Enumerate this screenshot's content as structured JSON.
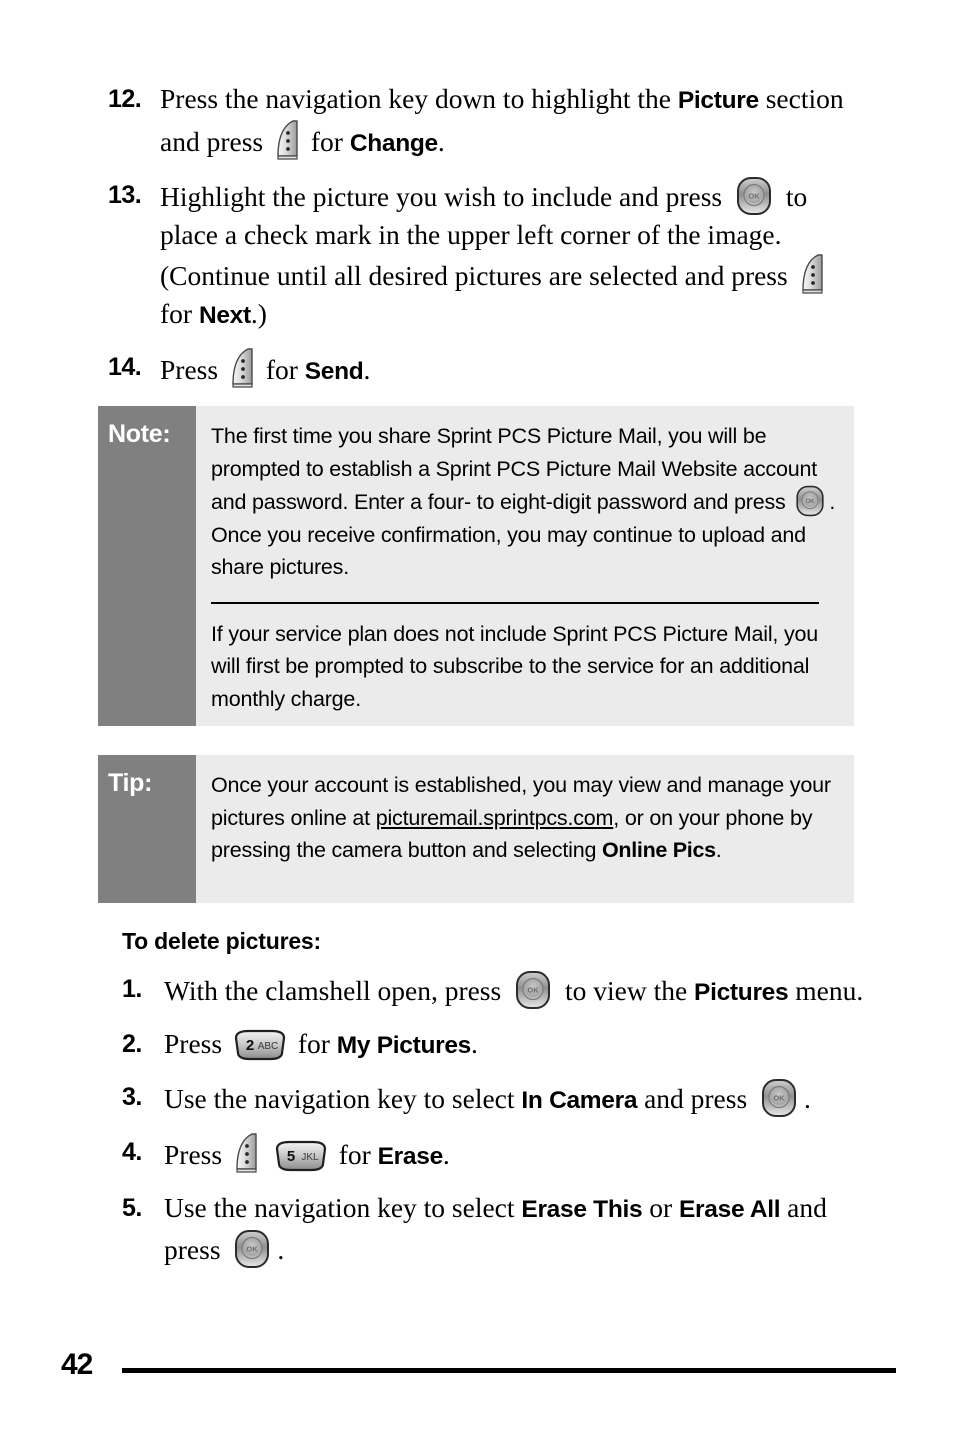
{
  "document": {
    "page_number": "42",
    "colors": {
      "callout_label_bg": "#808080",
      "callout_body_bg": "#ebebeb",
      "text": "#000000",
      "label_text": "#ffffff"
    }
  },
  "steps_top": [
    {
      "number": "12.",
      "parts": [
        {
          "type": "text",
          "value": "Press the navigation key down to highlight the "
        },
        {
          "type": "bold",
          "value": "Picture"
        },
        {
          "type": "text",
          "value": " section and press "
        },
        {
          "type": "icon",
          "value": "softkey-right-icon"
        },
        {
          "type": "text",
          "value": " for "
        },
        {
          "type": "bold",
          "value": "Change"
        },
        {
          "type": "text",
          "value": "."
        }
      ]
    },
    {
      "number": "13.",
      "parts": [
        {
          "type": "text",
          "value": "Highlight the picture you wish to include and press "
        },
        {
          "type": "icon",
          "value": "ok-navigation-key-icon"
        },
        {
          "type": "text",
          "value": " to place a check mark in the upper left corner of the image. (Continue until all desired pictures are selected and press "
        },
        {
          "type": "icon",
          "value": "softkey-right-icon"
        },
        {
          "type": "text",
          "value": " for "
        },
        {
          "type": "bold",
          "value": "Next"
        },
        {
          "type": "text",
          "value": ".)"
        }
      ]
    },
    {
      "number": "14.",
      "parts": [
        {
          "type": "text",
          "value": "Press "
        },
        {
          "type": "icon",
          "value": "softkey-right-icon"
        },
        {
          "type": "text",
          "value": " for "
        },
        {
          "type": "bold",
          "value": "Send"
        },
        {
          "type": "text",
          "value": "."
        }
      ]
    }
  ],
  "note_callout": {
    "label": "Note:",
    "paragraph_1_a": "The first time you share Sprint PCS Picture Mail, you will be prompted to establish a Sprint PCS Picture Mail Website account and password. Enter a four- to eight-digit password and press ",
    "paragraph_1_icon": "ok-navigation-key-icon",
    "paragraph_1_b": ". Once you receive confirmation, you may continue to upload and share pictures.",
    "paragraph_2": "If your service plan does not include Sprint PCS Picture Mail, you will first be prompted to subscribe to the service for an additional monthly charge."
  },
  "tip_callout": {
    "label": "Tip:",
    "text_a": "Once your account is established, you may view and manage your pictures online at ",
    "link": "picturemail.sprintpcs.com",
    "text_b": ", or on your phone by pressing the camera button and selecting ",
    "bold": "Online Pics",
    "text_c": "."
  },
  "subheading": "To delete pictures:",
  "steps_bottom": [
    {
      "number": "1.",
      "parts": [
        {
          "type": "text",
          "value": "With the clamshell open, press "
        },
        {
          "type": "icon",
          "value": "ok-navigation-key-icon"
        },
        {
          "type": "text",
          "value": " to view the "
        },
        {
          "type": "bold",
          "value": "Pictures"
        },
        {
          "type": "text",
          "value": " menu."
        }
      ]
    },
    {
      "number": "2.",
      "parts": [
        {
          "type": "text",
          "value": "Press "
        },
        {
          "type": "icon",
          "value": "keypad-2-abc-icon",
          "digit": "2",
          "letters": "ABC"
        },
        {
          "type": "text",
          "value": " for "
        },
        {
          "type": "bold",
          "value": "My Pictures"
        },
        {
          "type": "text",
          "value": "."
        }
      ]
    },
    {
      "number": "3.",
      "parts": [
        {
          "type": "text",
          "value": "Use the navigation key to select "
        },
        {
          "type": "bold",
          "value": "In Camera"
        },
        {
          "type": "text",
          "value": " and press "
        },
        {
          "type": "icon",
          "value": "ok-navigation-key-icon"
        },
        {
          "type": "text",
          "value": "."
        }
      ]
    },
    {
      "number": "4.",
      "parts": [
        {
          "type": "text",
          "value": "Press "
        },
        {
          "type": "icon",
          "value": "softkey-right-icon"
        },
        {
          "type": "text",
          "value": " "
        },
        {
          "type": "icon",
          "value": "keypad-5-jkl-icon",
          "digit": "5",
          "letters": "JKL"
        },
        {
          "type": "text",
          "value": " for "
        },
        {
          "type": "bold",
          "value": "Erase"
        },
        {
          "type": "text",
          "value": "."
        }
      ]
    },
    {
      "number": "5.",
      "parts": [
        {
          "type": "text",
          "value": "Use the navigation key to select "
        },
        {
          "type": "bold",
          "value": "Erase This"
        },
        {
          "type": "text",
          "value": " or "
        },
        {
          "type": "bold",
          "value": "Erase All"
        },
        {
          "type": "text",
          "value": " and press "
        },
        {
          "type": "icon",
          "value": "ok-navigation-key-icon"
        },
        {
          "type": "text",
          "value": "."
        }
      ]
    }
  ],
  "keys": {
    "key2_digit": "2",
    "key2_letters": "ABC",
    "key5_digit": "5",
    "key5_letters": "JKL",
    "ok_label": "OK"
  }
}
